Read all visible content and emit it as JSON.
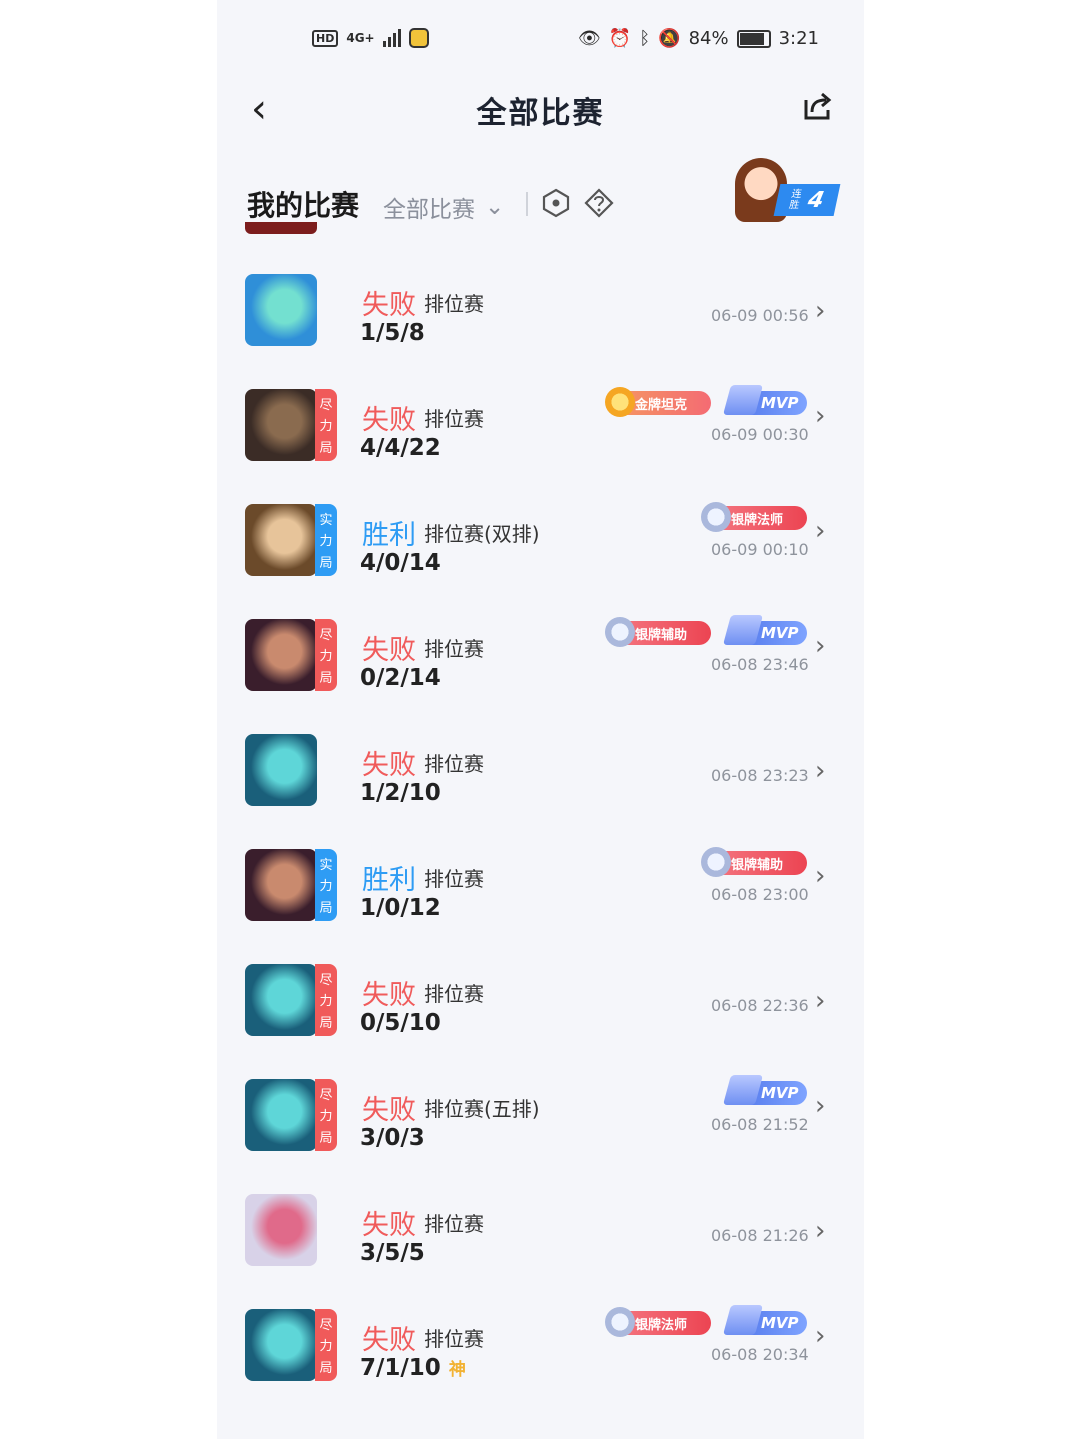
{
  "status_bar": {
    "network": "HD",
    "signal": "4G+",
    "battery_percent": "84%",
    "time": "3:21"
  },
  "header": {
    "back": "‹",
    "title": "全部比赛"
  },
  "filter": {
    "my_matches": "我的比赛",
    "selected": "全部比赛",
    "streak_label": "连胜",
    "streak_count": "4"
  },
  "matches": [
    {
      "result": "失败",
      "result_type": "lose",
      "mode": "排位赛",
      "kda": "1/5/8",
      "time": "06-09  00:56",
      "tag": "",
      "badges": [],
      "avatar_colors": [
        "#2f8fd8",
        "#73e0d0"
      ]
    },
    {
      "result": "失败",
      "result_type": "lose",
      "mode": "排位赛",
      "kda": "4/4/22",
      "time": "06-09  00:30",
      "tag": "尽力局",
      "badges": [
        "金牌坦克",
        "MVP"
      ],
      "avatar_colors": [
        "#3b2c26",
        "#8a6b4f"
      ]
    },
    {
      "result": "胜利",
      "result_type": "win",
      "mode": "排位赛(双排)",
      "kda": "4/0/14",
      "time": "06-09  00:10",
      "tag": "实力局",
      "badges": [
        "银牌法师"
      ],
      "avatar_colors": [
        "#6b4a2a",
        "#e7c49a"
      ]
    },
    {
      "result": "失败",
      "result_type": "lose",
      "mode": "排位赛",
      "kda": "0/2/14",
      "time": "06-08  23:46",
      "tag": "尽力局",
      "badges": [
        "银牌辅助",
        "MVP"
      ],
      "avatar_colors": [
        "#3a1e2c",
        "#c98a6e"
      ]
    },
    {
      "result": "失败",
      "result_type": "lose",
      "mode": "排位赛",
      "kda": "1/2/10",
      "time": "06-08  23:23",
      "tag": "",
      "badges": [],
      "avatar_colors": [
        "#1a5f7a",
        "#5ed6d8"
      ]
    },
    {
      "result": "胜利",
      "result_type": "win",
      "mode": "排位赛",
      "kda": "1/0/12",
      "time": "06-08  23:00",
      "tag": "实力局",
      "badges": [
        "银牌辅助"
      ],
      "avatar_colors": [
        "#3a1e2c",
        "#c98a6e"
      ]
    },
    {
      "result": "失败",
      "result_type": "lose",
      "mode": "排位赛",
      "kda": "0/5/10",
      "time": "06-08  22:36",
      "tag": "尽力局",
      "badges": [],
      "avatar_colors": [
        "#1a5f7a",
        "#5ed6d8"
      ]
    },
    {
      "result": "失败",
      "result_type": "lose",
      "mode": "排位赛(五排)",
      "kda": "3/0/3",
      "time": "06-08  21:52",
      "tag": "尽力局",
      "badges": [
        "MVP"
      ],
      "avatar_colors": [
        "#1a5f7a",
        "#5ed6d8"
      ]
    },
    {
      "result": "失败",
      "result_type": "lose",
      "mode": "排位赛",
      "kda": "3/5/5",
      "time": "06-08  21:26",
      "tag": "",
      "badges": [],
      "avatar_colors": [
        "#d8d2e8",
        "#e06a8a"
      ]
    },
    {
      "result": "失败",
      "result_type": "lose",
      "mode": "排位赛",
      "kda": "7/1/10",
      "kda_extra": "神",
      "time": "06-08  20:34",
      "tag": "尽力局",
      "badges": [
        "银牌法师",
        "MVP"
      ],
      "avatar_colors": [
        "#1a5f7a",
        "#5ed6d8"
      ]
    }
  ],
  "colors": {
    "lose": "#f05b5b",
    "win": "#2e9cf4",
    "tag_effort": "#f05a5a",
    "tag_strength": "#2e9cf4"
  }
}
